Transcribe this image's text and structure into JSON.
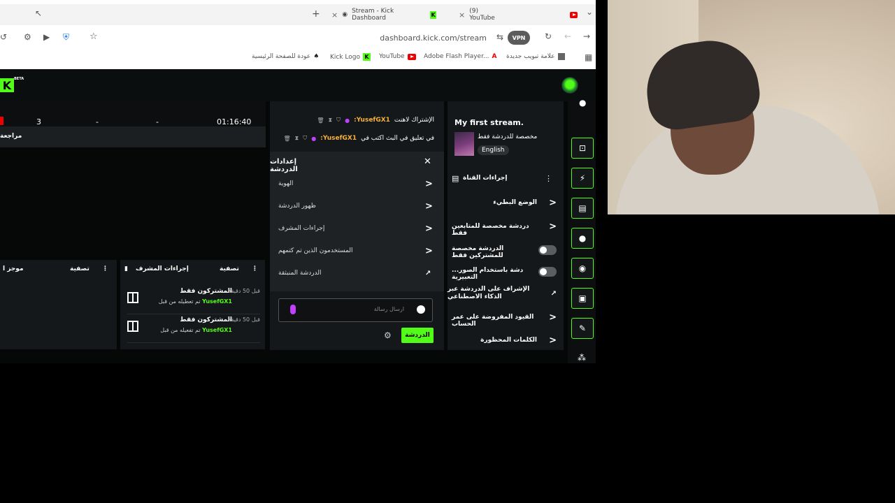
{
  "browser": {
    "tabs": [
      {
        "label": "Stream - Kick Dashboard",
        "close": "×"
      },
      {
        "label": "(9) YouTube",
        "close": "×"
      }
    ],
    "new_tab": "+",
    "window_menu": "⌄",
    "url": "dashboard.kick.com/stream",
    "vpn_badge": "VPN",
    "bookmarks": [
      "علامة تبويب جديدة",
      "Adobe Flash Player...",
      "YouTube",
      "Kick Logo",
      "عودة للصفحة الرئيسية"
    ]
  },
  "kick": {
    "logo": "K",
    "beta": "BETA"
  },
  "stats": {
    "viewers": "3",
    "stat2": "-",
    "stat3": "-",
    "duration": "01:16:40"
  },
  "review_label": "مراجعة",
  "panels": {
    "left_partial_title": "موجز ا",
    "filter_label": "تصفية",
    "mod_actions_title": "إجراءات المشرف",
    "mod_items": [
      {
        "title": "المشتركون فقط",
        "time": "قبل 50 دقيقة",
        "sub_prefix": "تم تعطيله من قبل",
        "user": "YusefGX1"
      },
      {
        "title": "المشتركون فقط",
        "time": "قبل 50 دقيقة",
        "sub_prefix": "تم تفعيله من قبل",
        "user": "YusefGX1"
      }
    ]
  },
  "chat": {
    "messages": [
      {
        "user": "YusefGX1:",
        "text": "الإشتراك لاهنت"
      },
      {
        "user": "YusefGX1:",
        "text": "في تعليق في البث اكتب في"
      }
    ],
    "settings_title": "إعدادات الدردشة",
    "settings_items": [
      "الهوية",
      "ظهور الدردشة",
      "إجراءات المشرف",
      "المستخدمون الذين تم كتمهم",
      "الدردشة المنبثقة"
    ],
    "input_placeholder": "ارسال رسالة",
    "send_button": "الدردشة"
  },
  "info": {
    "stream_title": "My first stream.",
    "mode": "مخصصة للدردشة فقط",
    "language": "English",
    "actions_title": "إجراءات القناة",
    "actions": [
      {
        "label": "الوضع البطيء",
        "kind": "chevron"
      },
      {
        "label": "دردشة مخصصة للمتابعين فقط",
        "kind": "chevron"
      },
      {
        "label": "الدردشة مخصصة للمشتركين فقط",
        "kind": "toggle"
      },
      {
        "label": "...دشة باستخدام الصور التعبيرية",
        "kind": "toggle"
      },
      {
        "label": "الإشراف على الدردشة عبر الذكاء الاصطناعي",
        "kind": "external"
      },
      {
        "label": "القيود المفروضة على عمر الحساب",
        "kind": "chevron"
      },
      {
        "label": "الكلمات المحظورة",
        "kind": "chevron"
      }
    ]
  }
}
